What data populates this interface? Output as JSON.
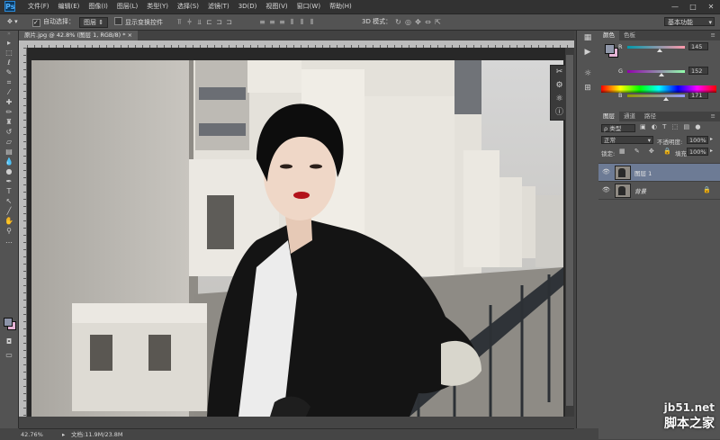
{
  "app": {
    "logo": "Ps"
  },
  "menu": [
    "文件(F)",
    "编辑(E)",
    "图像(I)",
    "图层(L)",
    "类型(Y)",
    "选择(S)",
    "滤镜(T)",
    "3D(D)",
    "视图(V)",
    "窗口(W)",
    "帮助(H)"
  ],
  "window_controls": [
    "—",
    "□",
    "✕"
  ],
  "options": {
    "auto_select_label": "自动选择：",
    "auto_select_value": "图层",
    "show_transform_label": "显示变换控件",
    "mode_3d_label": "3D 模式：",
    "workspace": "基本功能"
  },
  "document": {
    "tab": "原片.jpg @ 42.8% (图层 1, RGB/8) *"
  },
  "status": {
    "zoom": "42.76%",
    "doc_size": "文档:11.9M/23.8M"
  },
  "color_panel": {
    "tabs": [
      "颜色",
      "色板"
    ],
    "channels": [
      {
        "label": "R",
        "value": "145",
        "pct": 0.57
      },
      {
        "label": "G",
        "value": "152",
        "pct": 0.6
      },
      {
        "label": "B",
        "value": "171",
        "pct": 0.67
      }
    ],
    "fg_color": "#9198ab",
    "bg_color": "#e8b6d8"
  },
  "layers_panel": {
    "tabs": [
      "图层",
      "通道",
      "路径"
    ],
    "filter": "ρ 类型",
    "blend_mode": "正常",
    "opacity_label": "不透明度:",
    "opacity": "100%",
    "lock_label": "锁定:",
    "fill_label": "填充:",
    "fill": "100%",
    "layers": [
      {
        "name": "图层 1",
        "selected": true,
        "italic": false,
        "locked": false
      },
      {
        "name": "背景",
        "selected": false,
        "italic": true,
        "locked": true
      }
    ]
  },
  "watermark": {
    "site": "jb51.net",
    "name": "脚本之家"
  },
  "icons": {
    "move": "move-icon",
    "toolbar": [
      "move-tool-icon",
      "marquee-tool-icon",
      "lasso-tool-icon",
      "quick-select-tool-icon",
      "crop-tool-icon",
      "eyedropper-tool-icon",
      "healing-brush-icon",
      "brush-tool-icon",
      "clone-stamp-icon",
      "history-brush-icon",
      "eraser-tool-icon",
      "gradient-tool-icon",
      "blur-tool-icon",
      "dodge-tool-icon",
      "pen-tool-icon",
      "type-tool-icon",
      "path-select-icon",
      "shape-tool-icon",
      "hand-tool-icon",
      "zoom-tool-icon"
    ]
  }
}
